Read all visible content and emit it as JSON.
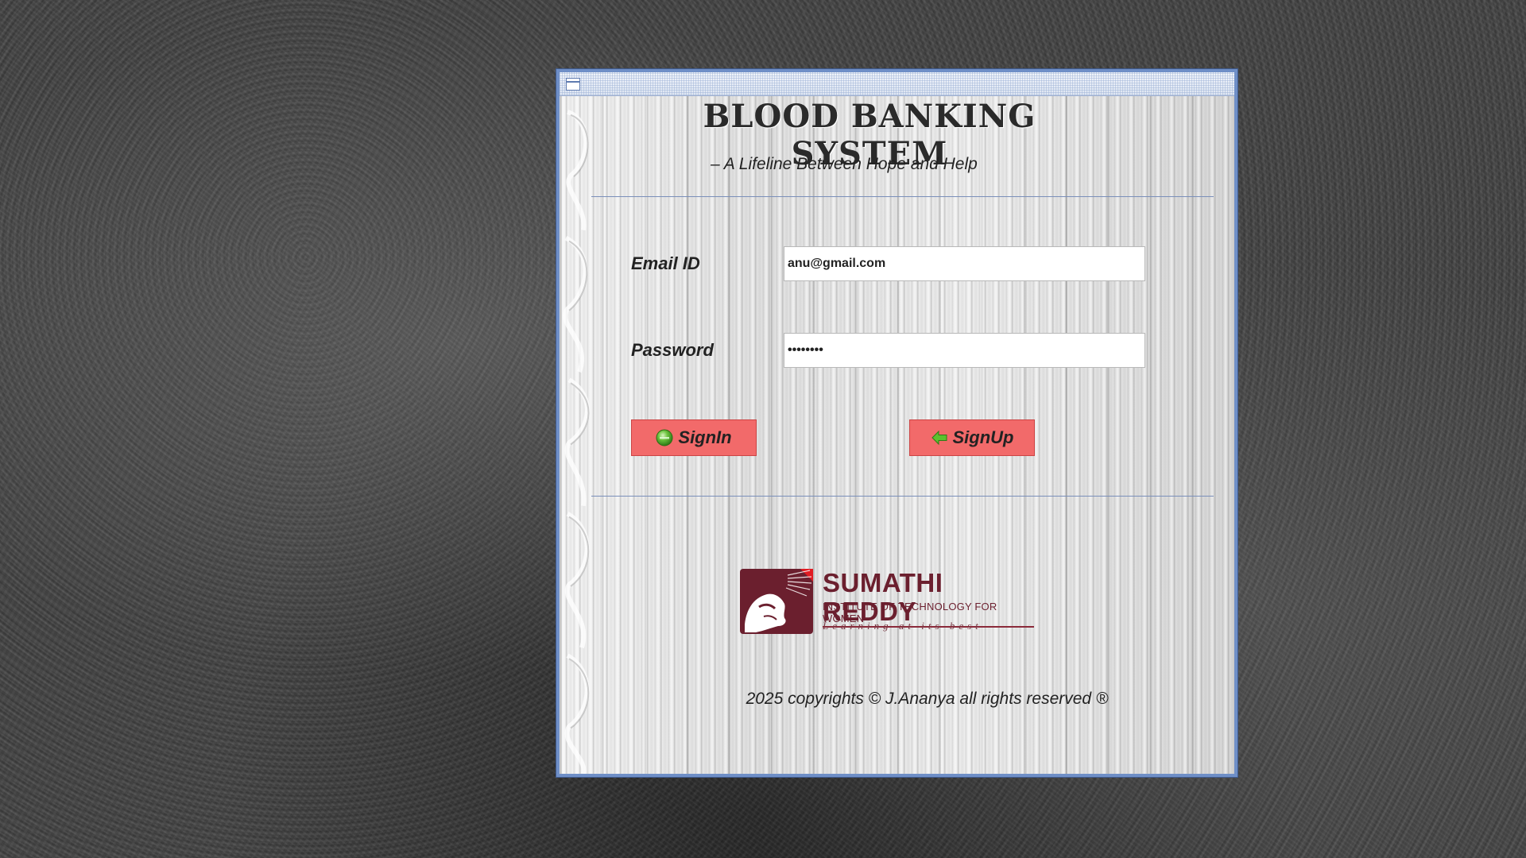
{
  "app": {
    "title": "BLOOD  BANKING SYSTEM",
    "subtitle": "– A Lifeline Between Hope and Help"
  },
  "form": {
    "email_label": "Email ID",
    "email_value": "anu@gmail.com",
    "password_label": "Password",
    "password_value": "••••••••",
    "signin_label": "SignIn",
    "signup_label": "SignUp"
  },
  "logo": {
    "name": "SUMATHI REDDY",
    "subtitle": "INSTITUTE OF TECHNOLOGY FOR WOMEN",
    "tagline": "Learning at its best"
  },
  "footer": {
    "copyright": "2025 copyrights © J.Ananya all rights reserved ®"
  },
  "colors": {
    "button_bg": "#f26a6a",
    "window_border": "#6f8fc7",
    "logo_color": "#6b1f2e"
  },
  "icons": {
    "window": "window-icon",
    "signin": "green-orb-icon",
    "signup": "green-arrow-left-icon"
  }
}
